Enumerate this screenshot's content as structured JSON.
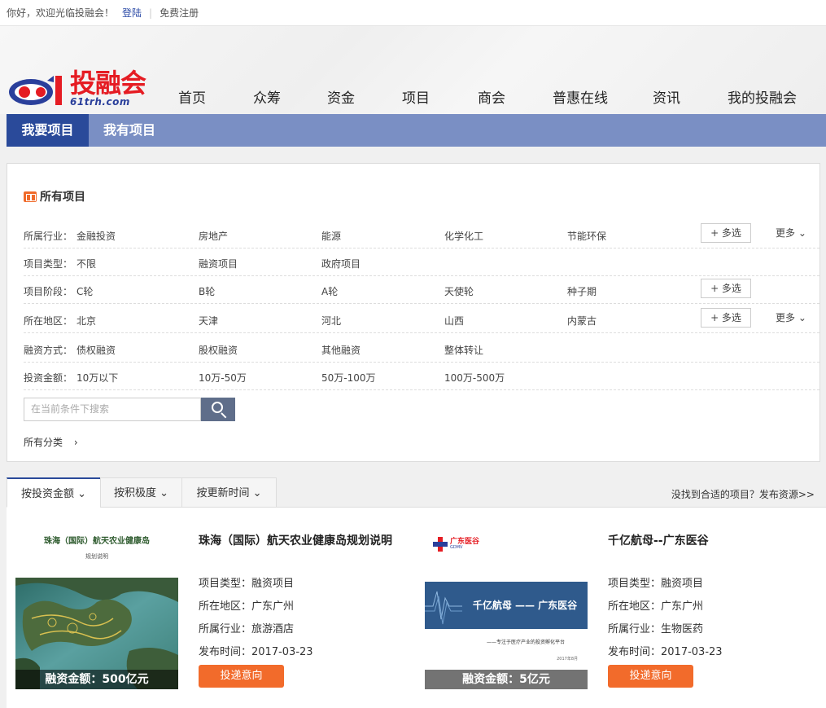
{
  "topbar": {
    "greeting": "你好，欢迎光临投融会！",
    "login": "登陆",
    "register": "免费注册"
  },
  "logo": {
    "cn": "投融会",
    "en": "61trh.com"
  },
  "nav": [
    "首页",
    "众筹",
    "资金",
    "项目",
    "商会",
    "普惠在线",
    "资讯",
    "我的投融会"
  ],
  "subnav": {
    "tab1": "我要项目",
    "tab2": "我有项目"
  },
  "filters": {
    "title": "所有项目",
    "multi": "+ 多选",
    "more": "更多",
    "rows": [
      {
        "label": "所属行业：",
        "options": [
          "金融投资",
          "房地产",
          "能源",
          "化学化工",
          "节能环保"
        ]
      },
      {
        "label": "项目类型：",
        "options": [
          "不限",
          "融资项目",
          "政府项目"
        ]
      },
      {
        "label": "项目阶段：",
        "options": [
          "C轮",
          "B轮",
          "A轮",
          "天使轮",
          "种子期"
        ]
      },
      {
        "label": "所在地区：",
        "options": [
          "北京",
          "天津",
          "河北",
          "山西",
          "内蒙古"
        ]
      },
      {
        "label": "融资方式：",
        "options": [
          "债权融资",
          "股权融资",
          "其他融资",
          "整体转让"
        ]
      },
      {
        "label": "投资金额：",
        "options": [
          "10万以下",
          "10万-50万",
          "50万-100万",
          "100万-500万"
        ]
      }
    ],
    "search_placeholder": "在当前条件下搜索",
    "all_categories": "所有分类"
  },
  "sort": {
    "tabs": [
      "按投资金额",
      "按积极度",
      "按更新时间"
    ],
    "right_text": "没找到合适的项目？发布资源>>"
  },
  "projects": [
    {
      "title": "珠海（国际）航天农业健康岛规划说明",
      "image_heading": "珠海（国际）航天农业健康岛",
      "image_sub": "规划说明",
      "amount": "融资金额：500亿元",
      "type": "项目类型：融资项目",
      "region": "所在地区：广东广州",
      "industry": "所属行业：旅游酒店",
      "date": "发布时间：2017-03-23",
      "button": "投递意向"
    },
    {
      "title": "千亿航母--广东医谷",
      "image_logo": "广东医谷",
      "image_logo_en": "GDMV",
      "image_heading": "千亿航母 —— 广东医谷",
      "image_sub": "——专注于医疗产业的投资孵化平台",
      "image_date": "2017年8月",
      "amount": "融资金额：5亿元",
      "type": "项目类型：融资项目",
      "region": "所在地区：广东广州",
      "industry": "所属行业：生物医药",
      "date": "发布时间：2017-03-23",
      "button": "投递意向"
    }
  ],
  "colors": {
    "brand_red": "#e51c23",
    "brand_blue": "#2a4a9a",
    "subnav": "#7a8fc4",
    "orange": "#f26b2b"
  }
}
